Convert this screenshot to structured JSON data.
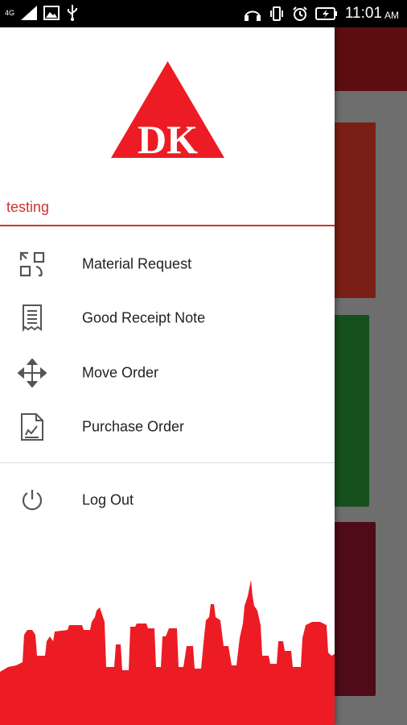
{
  "status_bar": {
    "network_label": "4G",
    "time": "11:01",
    "ampm": "AM"
  },
  "drawer": {
    "logo_text": "DK",
    "username": "testing",
    "menu": [
      {
        "label": "Material Request",
        "icon": "material-request-icon"
      },
      {
        "label": "Good Receipt Note",
        "icon": "receipt-icon"
      },
      {
        "label": "Move Order",
        "icon": "move-arrows-icon"
      },
      {
        "label": "Purchase Order",
        "icon": "purchase-order-icon"
      }
    ],
    "logout_label": "Log Out"
  },
  "colors": {
    "brand_red": "#ed1c24",
    "accent_red": "#d3322e"
  }
}
